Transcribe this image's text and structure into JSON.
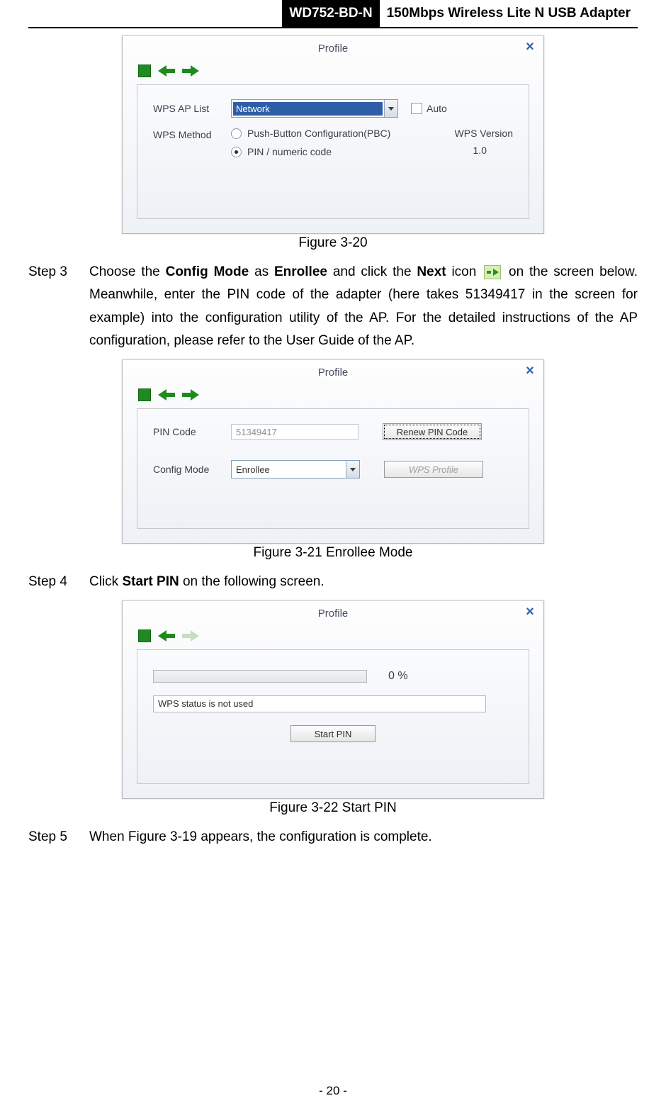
{
  "header": {
    "model": "WD752-BD-N",
    "product": "150Mbps Wireless Lite N USB Adapter"
  },
  "fig320": {
    "title": "Profile",
    "close": "×",
    "wps_ap_list_label": "WPS AP List",
    "wps_ap_list_value": "Network",
    "auto_label": "Auto",
    "wps_method_label": "WPS Method",
    "method_pbc": "Push-Button Configuration(PBC)",
    "method_pin": "PIN / numeric code",
    "wps_version_label": "WPS Version",
    "wps_version_value": "1.0",
    "caption": "Figure 3-20"
  },
  "step3": {
    "label": "Step 3",
    "text_a": "Choose the ",
    "bold_a": "Config Mode",
    "text_b": " as ",
    "bold_b": "Enrollee",
    "text_c": " and click the ",
    "bold_c": "Next",
    "text_d": " icon ",
    "text_e": " on the screen below. Meanwhile, enter the PIN code of the adapter (here takes 51349417 in the screen for example) into the configuration utility of the AP. For the detailed instructions of the AP configuration, please refer to the User Guide of the AP."
  },
  "fig321": {
    "title": "Profile",
    "close": "×",
    "pin_label": "PIN Code",
    "pin_value": "51349417",
    "renew_btn": "Renew PIN Code",
    "config_mode_label": "Config Mode",
    "config_mode_value": "Enrollee",
    "wps_profile_btn": "WPS Profile",
    "caption": "Figure 3-21 Enrollee Mode"
  },
  "step4": {
    "label": "Step 4",
    "text_a": "Click ",
    "bold_a": "Start PIN",
    "text_b": " on the following screen."
  },
  "fig322": {
    "title": "Profile",
    "close": "×",
    "progress_pct": "0 %",
    "status_text": "WPS status is not used",
    "start_btn": "Start PIN",
    "caption": "Figure 3-22 Start PIN"
  },
  "step5": {
    "label": "Step 5",
    "text": "When Figure 3-19 appears, the configuration is complete."
  },
  "page_number": "- 20 -"
}
